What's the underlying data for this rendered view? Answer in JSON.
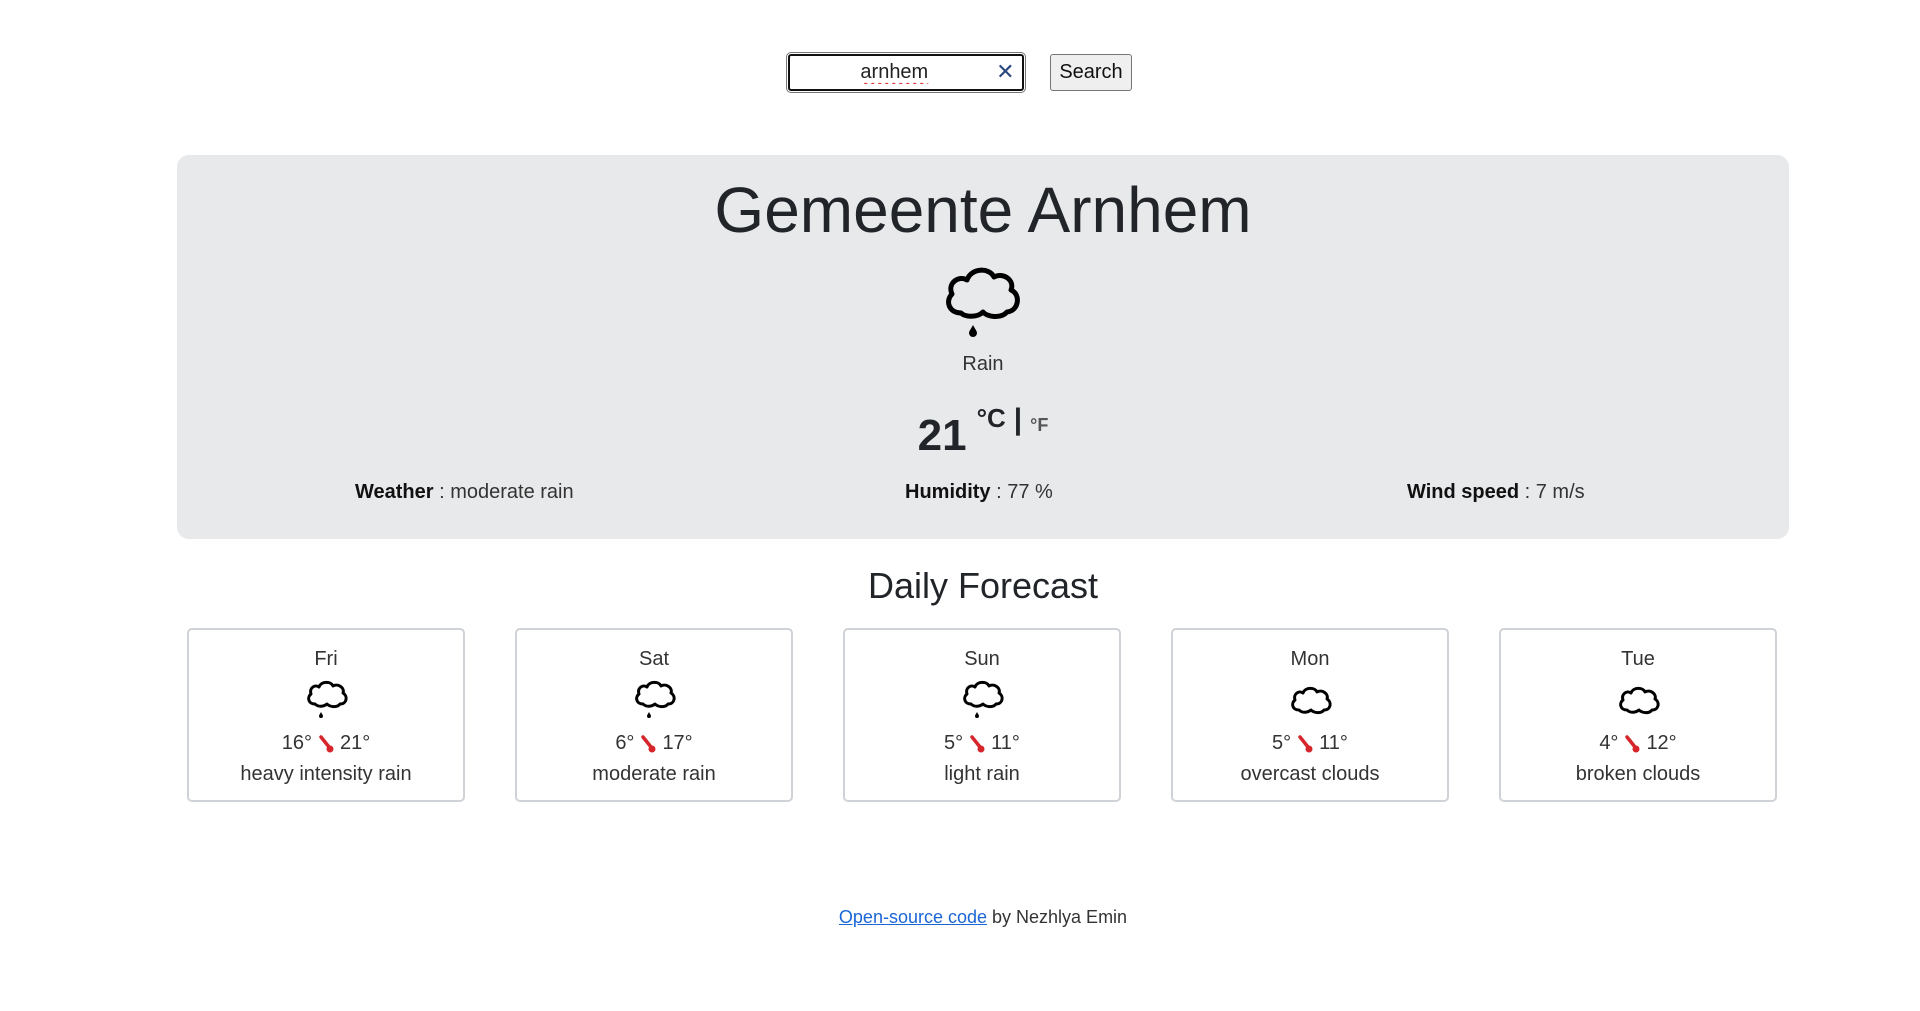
{
  "search": {
    "value": "arnhem",
    "clear_icon": "close-icon",
    "button_label": "Search"
  },
  "current": {
    "city": "Gemeente Arnhem",
    "icon": "rain-cloud-icon",
    "condition": "Rain",
    "temperature": "21",
    "unit_celsius": "°C",
    "unit_separator": "|",
    "unit_fahrenheit": "°F",
    "weather_label": "Weather",
    "weather_value": " : moderate rain",
    "humidity_label": "Humidity",
    "humidity_value": " : 77 %",
    "wind_label": "Wind speed",
    "wind_value": " : 7 m/s"
  },
  "forecast": {
    "title": "Daily Forecast",
    "days": [
      {
        "day": "Fri",
        "icon": "rain-cloud-icon",
        "min": "16°",
        "max": "21°",
        "desc": "heavy intensity rain"
      },
      {
        "day": "Sat",
        "icon": "rain-cloud-icon",
        "min": "6°",
        "max": "17°",
        "desc": "moderate rain"
      },
      {
        "day": "Sun",
        "icon": "rain-cloud-icon",
        "min": "5°",
        "max": "11°",
        "desc": "light rain"
      },
      {
        "day": "Mon",
        "icon": "cloud-icon",
        "min": "5°",
        "max": "11°",
        "desc": "overcast clouds"
      },
      {
        "day": "Tue",
        "icon": "cloud-icon",
        "min": "4°",
        "max": "12°",
        "desc": "broken clouds"
      }
    ]
  },
  "footer": {
    "link_text": "Open-source code",
    "suffix": " by Nezhlya Emin"
  },
  "colors": {
    "card_background": "#e8e9eb",
    "link": "#1a66d6",
    "thermometer": "#d7262b"
  }
}
